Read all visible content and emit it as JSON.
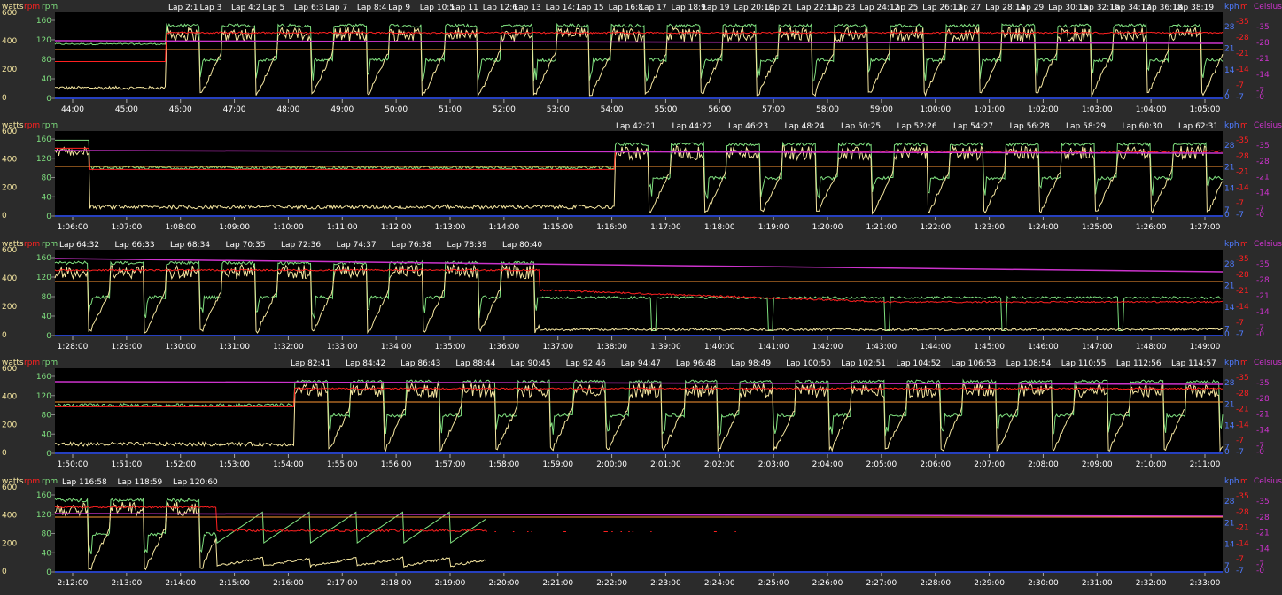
{
  "axis_labels": {
    "watts": "watts",
    "rpm": "rpm",
    "kph": "kph",
    "m": "m",
    "celsius": "Celsius"
  },
  "colors": {
    "background": "#2b2b2b",
    "plot_bg": "#000000",
    "watts": "#f5e6a0",
    "rpm_speed": "#ff2020",
    "cadence": "#7fe07f",
    "altitude": "#cc33cc",
    "temperature": "#ff9933",
    "zero_line": "#3355ff",
    "text": "#ffffff"
  },
  "chart_data": [
    {
      "type": "line",
      "left_ticks_watts": [
        "600",
        "400",
        "200",
        "0"
      ],
      "left_ticks_rpm": [
        "160",
        "120",
        "80",
        "40",
        "0"
      ],
      "right_ticks_kph": [
        "28",
        "21",
        "14",
        "7"
      ],
      "right_ticks_m": [
        "-35",
        "-28",
        "-21",
        "-14",
        "-7"
      ],
      "x_ticks": [
        "44:00",
        "45:00",
        "46:00",
        "47:00",
        "48:00",
        "49:00",
        "50:00",
        "51:00",
        "52:00",
        "53:00",
        "54:00",
        "55:00",
        "56:00",
        "57:00",
        "58:00",
        "59:00",
        "1:00:00",
        "1:01:00",
        "1:02:00",
        "1:03:00",
        "1:04:00",
        "1:05:00"
      ],
      "laps": [
        "Lap 2:1",
        "Lap 3",
        "Lap 4:2",
        "Lap 5",
        "Lap 6:3",
        "Lap 7",
        "Lap 8:4",
        "Lap 9",
        "Lap 10:5",
        "Lap 11",
        "Lap 12:6",
        "Lap 13",
        "Lap 14:7",
        "Lap 15",
        "Lap 16:8",
        "Lap 17",
        "Lap 18:9",
        "Lap 19",
        "Lap 20:10",
        "Lap 21",
        "Lap 22:11",
        "Lap 23",
        "Lap 24:12",
        "Lap 25",
        "Lap 26:13",
        "Lap 27",
        "Lap 28:14",
        "Lap 29",
        "Lap 30:15",
        "Lap 32:16",
        "Lap 34:17",
        "Lap 36:18",
        "Lap 38:19"
      ]
    },
    {
      "type": "line",
      "left_ticks_watts": [
        "600",
        "400",
        "200",
        "0"
      ],
      "left_ticks_rpm": [
        "160",
        "120",
        "80",
        "40",
        "0"
      ],
      "right_ticks_kph": [
        "28",
        "21",
        "14",
        "7"
      ],
      "right_ticks_m": [
        "-35",
        "-28",
        "-21",
        "-14",
        "-7"
      ],
      "x_ticks": [
        "1:06:00",
        "1:07:00",
        "1:08:00",
        "1:09:00",
        "1:10:00",
        "1:11:00",
        "1:12:00",
        "1:13:00",
        "1:14:00",
        "1:15:00",
        "1:16:00",
        "1:17:00",
        "1:18:00",
        "1:19:00",
        "1:20:00",
        "1:21:00",
        "1:22:00",
        "1:23:00",
        "1:24:00",
        "1:25:00",
        "1:26:00",
        "1:27:00"
      ],
      "laps": [
        "Lap 42:21",
        "Lap 44:22",
        "Lap 46:23",
        "Lap 48:24",
        "Lap 50:25",
        "Lap 52:26",
        "Lap 54:27",
        "Lap 56:28",
        "Lap 58:29",
        "Lap 60:30",
        "Lap 62:31"
      ]
    },
    {
      "type": "line",
      "left_ticks_watts": [
        "600",
        "400",
        "200",
        "0"
      ],
      "left_ticks_rpm": [
        "160",
        "120",
        "80",
        "40",
        "0"
      ],
      "right_ticks_kph": [
        "28",
        "21",
        "14",
        "7"
      ],
      "right_ticks_m": [
        "-35",
        "-28",
        "-21",
        "-14",
        "-7"
      ],
      "x_ticks": [
        "1:28:00",
        "1:29:00",
        "1:30:00",
        "1:31:00",
        "1:32:00",
        "1:33:00",
        "1:34:00",
        "1:35:00",
        "1:36:00",
        "1:37:00",
        "1:38:00",
        "1:39:00",
        "1:40:00",
        "1:41:00",
        "1:42:00",
        "1:43:00",
        "1:44:00",
        "1:45:00",
        "1:46:00",
        "1:47:00",
        "1:48:00",
        "1:49:00"
      ],
      "laps": [
        "Lap 64:32",
        "Lap 66:33",
        "Lap 68:34",
        "Lap 70:35",
        "Lap 72:36",
        "Lap 74:37",
        "Lap 76:38",
        "Lap 78:39",
        "Lap 80:40"
      ]
    },
    {
      "type": "line",
      "left_ticks_watts": [
        "600",
        "400",
        "200",
        "0"
      ],
      "left_ticks_rpm": [
        "160",
        "120",
        "80",
        "40",
        "0"
      ],
      "right_ticks_kph": [
        "28",
        "21",
        "14",
        "7"
      ],
      "right_ticks_m": [
        "-35",
        "-28",
        "-21",
        "-14",
        "-7"
      ],
      "x_ticks": [
        "1:50:00",
        "1:51:00",
        "1:52:00",
        "1:53:00",
        "1:54:00",
        "1:55:00",
        "1:56:00",
        "1:57:00",
        "1:58:00",
        "1:59:00",
        "2:00:00",
        "2:01:00",
        "2:02:00",
        "2:03:00",
        "2:04:00",
        "2:05:00",
        "2:06:00",
        "2:07:00",
        "2:08:00",
        "2:09:00",
        "2:10:00",
        "2:11:00"
      ],
      "laps": [
        "Lap 82:41",
        "Lap 84:42",
        "Lap 86:43",
        "Lap 88:44",
        "Lap 90:45",
        "Lap 92:46",
        "Lap 94:47",
        "Lap 96:48",
        "Lap 98:49",
        "Lap 100:50",
        "Lap 102:51",
        "Lap 104:52",
        "Lap 106:53",
        "Lap 108:54",
        "Lap 110:55",
        "Lap 112:56",
        "Lap 114:57"
      ]
    },
    {
      "type": "line",
      "left_ticks_watts": [
        "600",
        "400",
        "200",
        "0"
      ],
      "left_ticks_rpm": [
        "160",
        "120",
        "80",
        "40",
        "0"
      ],
      "right_ticks_kph": [
        "28",
        "21",
        "14",
        "7"
      ],
      "right_ticks_m": [
        "-35",
        "-28",
        "-21",
        "-14",
        "-7"
      ],
      "x_ticks": [
        "2:12:00",
        "2:13:00",
        "2:14:00",
        "2:15:00",
        "2:16:00",
        "2:17:00",
        "2:18:00",
        "2:19:00",
        "2:20:00",
        "2:21:00",
        "2:22:00",
        "2:23:00",
        "2:24:00",
        "2:25:00",
        "2:26:00",
        "2:27:00",
        "2:28:00",
        "2:29:00",
        "2:30:00",
        "2:31:00",
        "2:32:00",
        "2:33:00"
      ],
      "laps": [
        "Lap 116:58",
        "Lap 118:59",
        "Lap 120:60"
      ]
    }
  ]
}
